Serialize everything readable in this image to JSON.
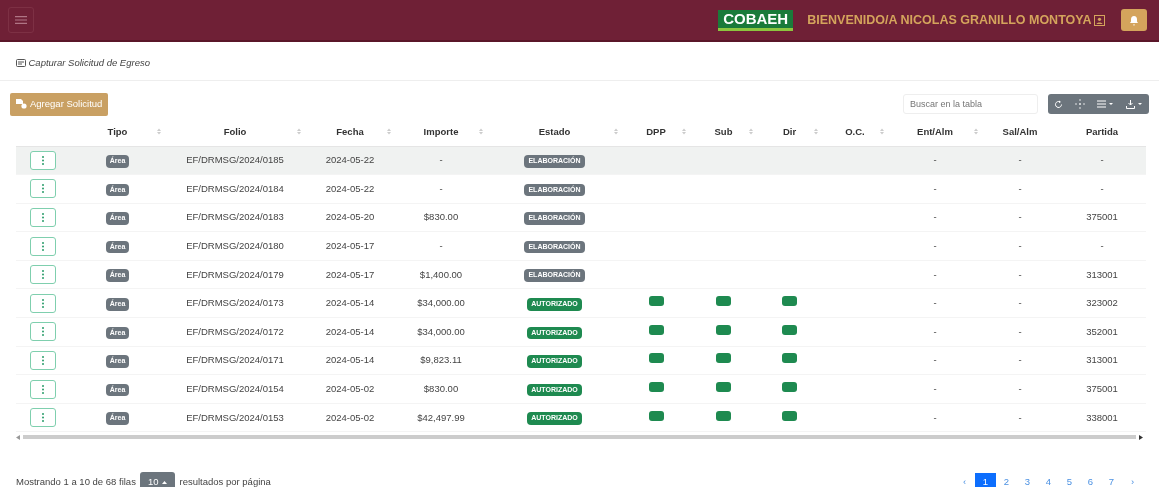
{
  "navbar": {
    "logo": "COBAEH",
    "welcome": "BIENVENIDO/A NICOLAS GRANILLO MONTOYA"
  },
  "breadcrumb": "Capturar Solicitud de Egreso",
  "add_button": "Agregar Solicitud",
  "search": {
    "placeholder": "Buscar en la tabla"
  },
  "table": {
    "columns": [
      {
        "sortable": false
      },
      {
        "label": "Tipo",
        "sortable": true
      },
      {
        "label": "Folio",
        "sortable": true
      },
      {
        "label": "Fecha",
        "sortable": true
      },
      {
        "label": "Importe",
        "sortable": true
      },
      {
        "label": "Estado",
        "sortable": true
      },
      {
        "label": "DPP",
        "sortable": true
      },
      {
        "label": "Sub",
        "sortable": true
      },
      {
        "label": "Dir",
        "sortable": true
      },
      {
        "label": "O.C.",
        "sortable": true
      },
      {
        "label": "Ent/Alm",
        "sortable": true
      },
      {
        "label": "Sal/Alm",
        "sortable": false
      },
      {
        "label": "Partida",
        "sortable": false
      }
    ],
    "rows": [
      {
        "selected": true,
        "tipo": "Área",
        "folio": "EF/DRMSG/2024/0185",
        "fecha": "2024-05-22",
        "importe": "-",
        "estado": {
          "kind": "draft",
          "label": "ELABORACIÓN"
        },
        "dpp": false,
        "sub": false,
        "dir": false,
        "ent": "-",
        "sal": "-",
        "partida": "-"
      },
      {
        "selected": false,
        "tipo": "Área",
        "folio": "EF/DRMSG/2024/0184",
        "fecha": "2024-05-22",
        "importe": "-",
        "estado": {
          "kind": "draft",
          "label": "ELABORACIÓN"
        },
        "dpp": false,
        "sub": false,
        "dir": false,
        "ent": "-",
        "sal": "-",
        "partida": "-"
      },
      {
        "selected": false,
        "tipo": "Área",
        "folio": "EF/DRMSG/2024/0183",
        "fecha": "2024-05-20",
        "importe": "$830.00",
        "estado": {
          "kind": "draft",
          "label": "ELABORACIÓN"
        },
        "dpp": false,
        "sub": false,
        "dir": false,
        "ent": "-",
        "sal": "-",
        "partida": "375001"
      },
      {
        "selected": false,
        "tipo": "Área",
        "folio": "EF/DRMSG/2024/0180",
        "fecha": "2024-05-17",
        "importe": "-",
        "estado": {
          "kind": "draft",
          "label": "ELABORACIÓN"
        },
        "dpp": false,
        "sub": false,
        "dir": false,
        "ent": "-",
        "sal": "-",
        "partida": "-"
      },
      {
        "selected": false,
        "tipo": "Área",
        "folio": "EF/DRMSG/2024/0179",
        "fecha": "2024-05-17",
        "importe": "$1,400.00",
        "estado": {
          "kind": "draft",
          "label": "ELABORACIÓN"
        },
        "dpp": false,
        "sub": false,
        "dir": false,
        "ent": "-",
        "sal": "-",
        "partida": "313001"
      },
      {
        "selected": false,
        "tipo": "Área",
        "folio": "EF/DRMSG/2024/0173",
        "fecha": "2024-05-14",
        "importe": "$34,000.00",
        "estado": {
          "kind": "approved",
          "label": "AUTORIZADO"
        },
        "dpp": true,
        "sub": true,
        "dir": true,
        "ent": "-",
        "sal": "-",
        "partida": "323002"
      },
      {
        "selected": false,
        "tipo": "Área",
        "folio": "EF/DRMSG/2024/0172",
        "fecha": "2024-05-14",
        "importe": "$34,000.00",
        "estado": {
          "kind": "approved",
          "label": "AUTORIZADO"
        },
        "dpp": true,
        "sub": true,
        "dir": true,
        "ent": "-",
        "sal": "-",
        "partida": "352001"
      },
      {
        "selected": false,
        "tipo": "Área",
        "folio": "EF/DRMSG/2024/0171",
        "fecha": "2024-05-14",
        "importe": "$9,823.11",
        "estado": {
          "kind": "approved",
          "label": "AUTORIZADO"
        },
        "dpp": true,
        "sub": true,
        "dir": true,
        "ent": "-",
        "sal": "-",
        "partida": "313001"
      },
      {
        "selected": false,
        "tipo": "Área",
        "folio": "EF/DRMSG/2024/0154",
        "fecha": "2024-05-02",
        "importe": "$830.00",
        "estado": {
          "kind": "approved",
          "label": "AUTORIZADO"
        },
        "dpp": true,
        "sub": true,
        "dir": true,
        "ent": "-",
        "sal": "-",
        "partida": "375001"
      },
      {
        "selected": false,
        "tipo": "Área",
        "folio": "EF/DRMSG/2024/0153",
        "fecha": "2024-05-02",
        "importe": "$42,497.99",
        "estado": {
          "kind": "approved",
          "label": "AUTORIZADO"
        },
        "dpp": true,
        "sub": true,
        "dir": true,
        "ent": "-",
        "sal": "-",
        "partida": "338001"
      }
    ]
  },
  "footer": {
    "showing": "Mostrando 1 a 10 de 68 filas",
    "page_size": "10",
    "per_page": "resultados por página"
  },
  "pagination": {
    "prev": "‹",
    "next": "›",
    "pages": [
      {
        "label": "1",
        "selected": true
      },
      {
        "label": "2",
        "selected": false
      },
      {
        "label": "3",
        "selected": false
      },
      {
        "label": "4",
        "selected": false
      },
      {
        "label": "5",
        "selected": false
      },
      {
        "label": "6",
        "selected": false
      },
      {
        "label": "7",
        "selected": false
      }
    ]
  }
}
